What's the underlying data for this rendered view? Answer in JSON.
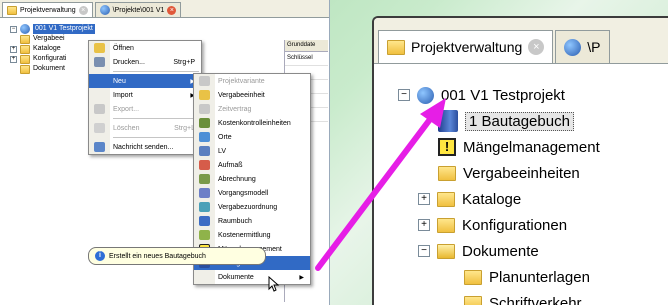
{
  "left": {
    "tabs": [
      {
        "label": "Projektverwaltung"
      },
      {
        "label": "\\Projekte\\001 V1"
      }
    ],
    "tree": [
      {
        "label": "001 V1 Testprojekt",
        "selected": true
      },
      {
        "label": "Vergabeei"
      },
      {
        "label": "Kataloge"
      },
      {
        "label": "Konfigurati"
      },
      {
        "label": "Dokument"
      }
    ],
    "side_panel": {
      "header": "Grunddate",
      "rows": [
        "Schlüssel",
        "",
        "",
        "",
        ""
      ]
    },
    "context_menu": [
      {
        "label": "Öffnen",
        "shortcut": "",
        "disabled": false
      },
      {
        "label": "Drucken...",
        "shortcut": "Strg+P",
        "disabled": false
      },
      {
        "label": "Neu",
        "shortcut": "",
        "disabled": false,
        "submenu": true,
        "highlight": true
      },
      {
        "label": "Import",
        "shortcut": "",
        "disabled": false,
        "submenu": true
      },
      {
        "label": "Export...",
        "shortcut": "",
        "disabled": true
      },
      {
        "label": "Löschen",
        "shortcut": "Strg+L",
        "disabled": true
      },
      {
        "label": "Nachricht senden...",
        "shortcut": "",
        "disabled": false
      }
    ],
    "submenu": [
      {
        "label": "Projektvariante",
        "disabled": true
      },
      {
        "label": "Vergabeeinheit",
        "disabled": false
      },
      {
        "label": "Zeitvertrag",
        "disabled": true
      },
      {
        "label": "Kostenkontrolleinheiten",
        "disabled": false
      },
      {
        "label": "Orte",
        "disabled": false
      },
      {
        "label": "LV",
        "disabled": false
      },
      {
        "label": "Aufmaß",
        "disabled": false
      },
      {
        "label": "Abrechnung",
        "disabled": false
      },
      {
        "label": "Vorgangsmodell",
        "disabled": false
      },
      {
        "label": "Vergabezuordnung",
        "disabled": false
      },
      {
        "label": "Raumbuch",
        "disabled": false
      },
      {
        "label": "Kostenermittlung",
        "disabled": false
      },
      {
        "label": "Mängelmanagement",
        "disabled": false
      },
      {
        "label": "Bautagebuch",
        "disabled": false,
        "highlight": true
      },
      {
        "label": "Dokumente",
        "disabled": false,
        "submenu": true
      }
    ],
    "tooltip": "Erstellt ein neues Bautagebuch"
  },
  "right": {
    "tabs": [
      {
        "label": "Projektverwaltung"
      },
      {
        "label": "\\P"
      }
    ],
    "tree": [
      {
        "label": "001 V1 Testprojekt"
      },
      {
        "label": "1 Bautagebuch"
      },
      {
        "label": "Mängelmanagement"
      },
      {
        "label": "Vergabeeinheiten"
      },
      {
        "label": "Kataloge"
      },
      {
        "label": "Konfigurationen"
      },
      {
        "label": "Dokumente"
      },
      {
        "label": "Planunterlagen"
      },
      {
        "label": "Schriftverkehr"
      }
    ]
  },
  "colors": {
    "selection": "#316ac5",
    "arrow": "#e61ee6",
    "background": "#b9e3be"
  }
}
